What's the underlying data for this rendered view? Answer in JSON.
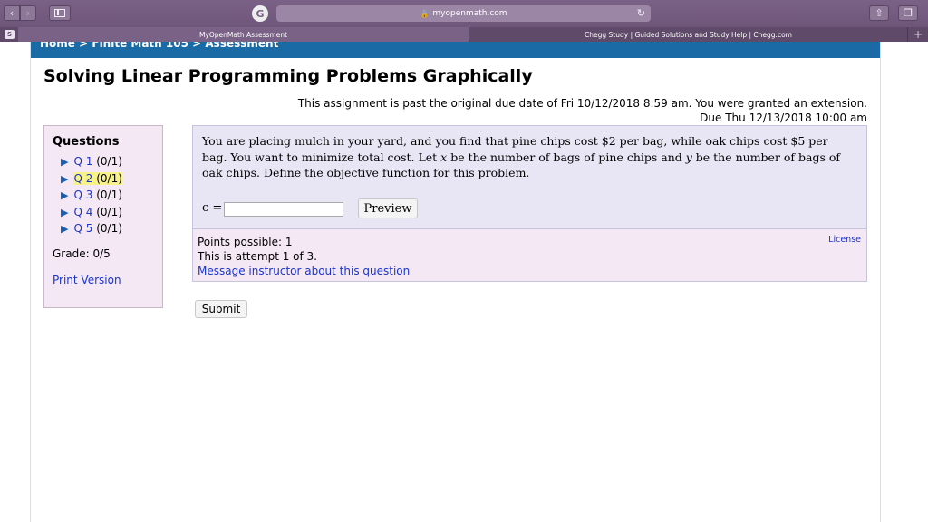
{
  "browser": {
    "url": "myopenmath.com",
    "tabs": [
      {
        "label": "MyOpenMath Assessment"
      },
      {
        "label": "Chegg Study | Guided Solutions and Study Help | Chegg.com"
      }
    ],
    "tab_favicon": "S"
  },
  "breadcrumb": {
    "home": "Home",
    "sep": ">",
    "course": "Finite Math 105",
    "current": "Assessment"
  },
  "page_title": "Solving Linear Programming Problems Graphically",
  "due": {
    "line1": "This assignment is past the original due date of Fri 10/12/2018 8:59 am. You were granted an extension.",
    "line2": "Due Thu 12/13/2018 10:00 am"
  },
  "nav": {
    "heading": "Questions",
    "questions": [
      {
        "label": "Q 1",
        "score": "(0/1)"
      },
      {
        "label": "Q 2",
        "score": "(0/1)"
      },
      {
        "label": "Q 3",
        "score": "(0/1)"
      },
      {
        "label": "Q 4",
        "score": "(0/1)"
      },
      {
        "label": "Q 5",
        "score": "(0/1)"
      }
    ],
    "grade": "Grade: 0/5",
    "print_version": "Print Version"
  },
  "question": {
    "part1": "You are placing mulch in your yard, and you find that pine chips cost $2 per bag, while oak chips cost $5 per bag. You want to minimize total cost. Let ",
    "var_x": "x",
    "part2": " be the number of bags of pine chips and ",
    "var_y": "y",
    "part3": " be the number of bags of oak chips. Define the objective function for this problem.",
    "answer_label": "c =",
    "answer_value": "",
    "preview_label": "Preview"
  },
  "info": {
    "points": "Points possible: 1",
    "attempt": "This is attempt 1 of 3.",
    "message_link": "Message instructor about this question",
    "license": "License"
  },
  "submit_label": "Submit",
  "colors": {
    "chrome": "#7a6186",
    "breadcrumb_bar": "#1a6aa6",
    "link": "#1a35c9",
    "current_highlight": "#f7f38a",
    "nav_bg": "#f5e8f5",
    "question_bg": "#e8e6f5"
  }
}
